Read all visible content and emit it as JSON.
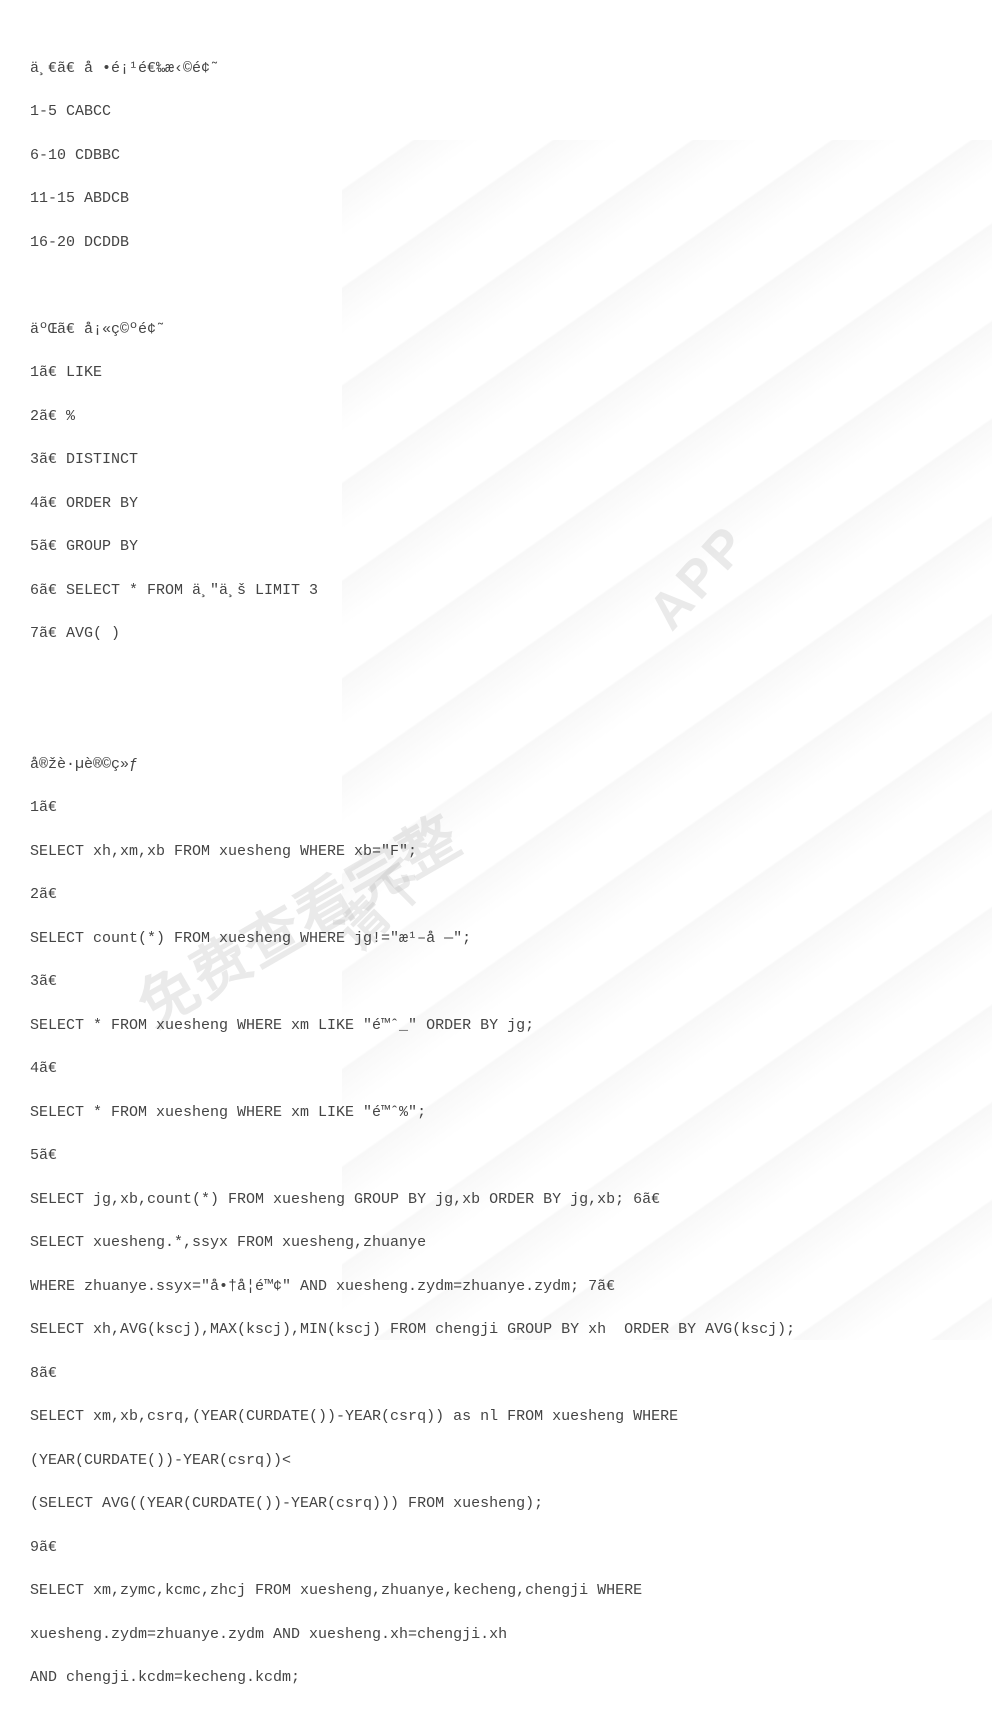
{
  "section1": {
    "heading": "ä¸€ã€ å •é¡¹é€‰æ‹©é¢˜",
    "answers": [
      "1-5 CABCC",
      "6-10 CDBBC",
      "11-15 ABDCB",
      "16-20 DCDDB"
    ]
  },
  "section2": {
    "heading": "äºŒã€ å¡«ç©ºé¢˜",
    "items": [
      "1ã€ LIKE",
      "2ã€ %",
      "3ã€ DISTINCT",
      "4ã€ ORDER BY",
      "5ã€ GROUP BY",
      "6ã€ SELECT * FROM ä¸\"ä¸š LIMIT 3",
      "7ã€ AVG( )"
    ]
  },
  "section3": {
    "heading": "å®žè·µè®©ç»ƒ",
    "items": [
      {
        "label": "1ã€",
        "sql": "SELECT xh,xm,xb FROM xuesheng WHERE xb=\"F\";"
      },
      {
        "label": "2ã€",
        "sql": "SELECT count(*) FROM xuesheng WHERE jg!=\"æ¹–å —\";"
      },
      {
        "label": "3ã€",
        "sql": "SELECT * FROM xuesheng WHERE xm LIKE \"é™ˆ_\" ORDER BY jg;"
      },
      {
        "label": "4ã€",
        "sql": "SELECT * FROM xuesheng WHERE xm LIKE \"é™ˆ%\";"
      },
      {
        "label": "5ã€",
        "sql": "SELECT jg,xb,count(*) FROM xuesheng GROUP BY jg,xb ORDER BY jg,xb; 6ã€"
      },
      {
        "label": "",
        "sql": "SELECT xuesheng.*,ssyx FROM xuesheng,zhuanye"
      },
      {
        "label": "",
        "sql": "WHERE zhuanye.ssyx=\"å•†å­¦é™¢\" AND xuesheng.zydm=zhuanye.zydm; 7ã€"
      },
      {
        "label": "",
        "sql": "SELECT xh,AVG(kscj),MAX(kscj),MIN(kscj) FROM chengji GROUP BY xh  ORDER BY AVG(kscj);"
      },
      {
        "label": "8ã€",
        "sql": ""
      },
      {
        "label": "",
        "sql": "SELECT xm,xb,csrq,(YEAR(CURDATE())-YEAR(csrq)) as nl FROM xuesheng WHERE"
      },
      {
        "label": "",
        "sql": "(YEAR(CURDATE())-YEAR(csrq))<"
      },
      {
        "label": "",
        "sql": "(SELECT AVG((YEAR(CURDATE())-YEAR(csrq))) FROM xuesheng);"
      },
      {
        "label": "9ã€",
        "sql": ""
      },
      {
        "label": "",
        "sql": "SELECT xm,zymc,kcmc,zhcj FROM xuesheng,zhuanye,kecheng,chengji WHERE"
      },
      {
        "label": "",
        "sql": "xuesheng.zydm=zhuanye.zydm AND xuesheng.xh=chengji.xh"
      },
      {
        "label": "",
        "sql": "AND chengji.kcdm=kecheng.kcdm;"
      }
    ]
  },
  "watermarks": {
    "wm1": "免费查看完整",
    "wm2": "请下",
    "wm3": "APP"
  }
}
